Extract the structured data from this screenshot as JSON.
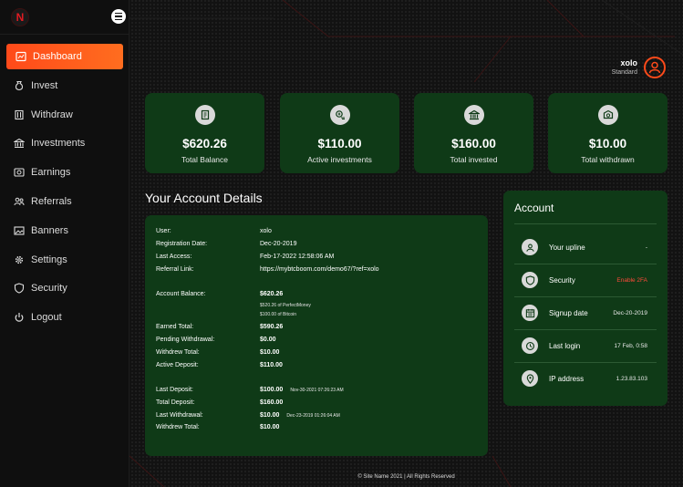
{
  "brand": {
    "logo_letter": "N",
    "accent": "#ff4a1a",
    "card_bg": "#0f3a17"
  },
  "sidebar": {
    "items": [
      {
        "label": "Dashboard",
        "icon": "dashboard-icon",
        "active": true
      },
      {
        "label": "Invest",
        "icon": "money-bag-icon"
      },
      {
        "label": "Withdraw",
        "icon": "withdraw-icon"
      },
      {
        "label": "Investments",
        "icon": "bank-icon"
      },
      {
        "label": "Earnings",
        "icon": "earnings-icon"
      },
      {
        "label": "Referrals",
        "icon": "users-icon"
      },
      {
        "label": "Banners",
        "icon": "image-icon"
      },
      {
        "label": "Settings",
        "icon": "gear-icon"
      },
      {
        "label": "Security",
        "icon": "shield-icon"
      },
      {
        "label": "Logout",
        "icon": "power-icon"
      }
    ]
  },
  "header": {
    "user_name": "xolo",
    "user_role": "Standard"
  },
  "stats": [
    {
      "value": "$620.26",
      "label": "Total Balance",
      "icon": "wallet-icon"
    },
    {
      "value": "$110.00",
      "label": "Active investments",
      "icon": "coin-hand-icon"
    },
    {
      "value": "$160.00",
      "label": "Total invested",
      "icon": "bank-icon"
    },
    {
      "value": "$10.00",
      "label": "Total withdrawn",
      "icon": "withdraw-box-icon"
    }
  ],
  "details": {
    "title": "Your Account Details",
    "user_label": "User:",
    "user_value": "xolo",
    "reg_label": "Registration Date:",
    "reg_value": "Dec-20-2019",
    "access_label": "Last Access:",
    "access_value": "Feb-17-2022 12:58:06 AM",
    "ref_label": "Referral Link:",
    "ref_value": "https://mybtcboom.com/demo67/?ref=xolo",
    "balance_label": "Account Balance:",
    "balance_value": "$620.26",
    "balance_note_1": "$520.26 of PerfectMoney",
    "balance_note_2": "$100.00 of Bitcoin",
    "earned_label": "Earned Total:",
    "earned_value": "$590.26",
    "pending_label": "Pending Withdrawal:",
    "pending_value": "$0.00",
    "withdrew_label": "Withdrew Total:",
    "withdrew_value": "$10.00",
    "active_label": "Active Deposit:",
    "active_value": "$110.00",
    "last_dep_label": "Last Deposit:",
    "last_dep_value": "$100.00",
    "last_dep_date": "Nov-30-2021 07:26:23 AM",
    "total_dep_label": "Total Deposit:",
    "total_dep_value": "$160.00",
    "last_wd_label": "Last Withdrawal:",
    "last_wd_value": "$10.00",
    "last_wd_date": "Dec-23-2019 01:26:04 AM",
    "withdrew2_label": "Withdrew Total:",
    "withdrew2_value": "$10.00"
  },
  "account": {
    "title": "Account",
    "rows": [
      {
        "label": "Your upline",
        "value": "-",
        "icon": "user-circle-icon"
      },
      {
        "label": "Security",
        "value": "Enable 2FA",
        "icon": "shield-icon",
        "warn": true
      },
      {
        "label": "Signup date",
        "value": "Dec-20-2019",
        "icon": "calendar-icon"
      },
      {
        "label": "Last login",
        "value": "17 Feb, 0:58",
        "icon": "clock-icon"
      },
      {
        "label": "IP address",
        "value": "1.23.83.103",
        "icon": "location-icon"
      }
    ]
  },
  "footer": {
    "text": "© Site Name 2021 | All Rights Reserved"
  }
}
